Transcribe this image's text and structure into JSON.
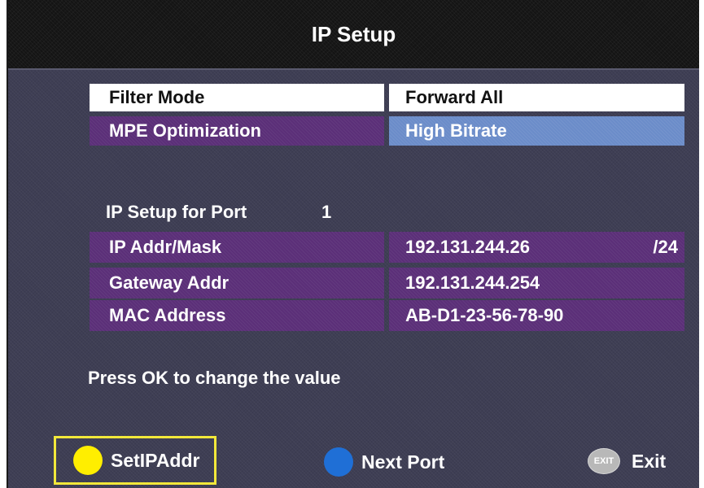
{
  "screen": {
    "title": "IP Setup"
  },
  "settings": [
    {
      "label": "Filter Mode",
      "value": "Forward All"
    },
    {
      "label": "MPE Optimization",
      "value": "High Bitrate"
    }
  ],
  "port_section": {
    "label": "IP Setup for Port",
    "port": "1"
  },
  "port_fields": [
    {
      "label": "IP Addr/Mask",
      "value": "192.131.244.26",
      "suffix": "/24"
    },
    {
      "label": "Gateway Addr",
      "value": "192.131.244.254"
    },
    {
      "label": "MAC Address",
      "value": "AB-D1-23-56-78-90"
    }
  ],
  "hint": "Press OK to change the value",
  "footer": {
    "set_ip_label": "SetIPAddr",
    "next_port_label": "Next Port",
    "exit_icon_text": "EXIT",
    "exit_label": "Exit"
  },
  "colors": {
    "background": "#3e3e54",
    "title_bar": "#141414",
    "row_purple": "#5b2f78",
    "selected_white": "#ffffff",
    "value_highlight_blue": "#6b8cc9",
    "yellow_key": "#ffee00",
    "blue_key": "#1f6fd6",
    "highlight_border": "#f2e83a"
  },
  "icons": [
    "yellow-key-icon",
    "blue-key-icon",
    "exit-key-icon"
  ]
}
